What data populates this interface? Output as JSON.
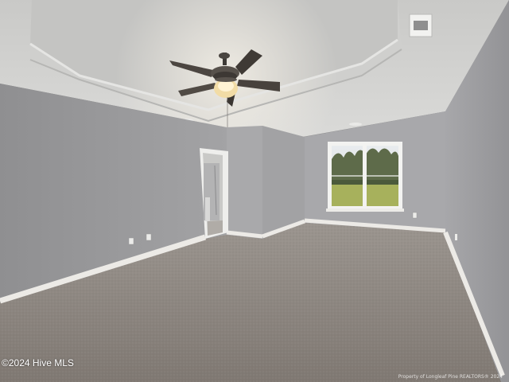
{
  "scene": {
    "subject": "Empty carpeted room with tray ceiling, ceiling fan, window and open doorway",
    "colors": {
      "wall": "#9e9ea0",
      "ceiling": "#d8d8d6",
      "carpet": "#8d8680",
      "trim": "#eceae6",
      "grass": "#a7b15c"
    }
  },
  "overlay": {
    "watermark": "©2024 Hive MLS",
    "credit": "Property of Longleaf Pine REALTORS® 2024"
  }
}
